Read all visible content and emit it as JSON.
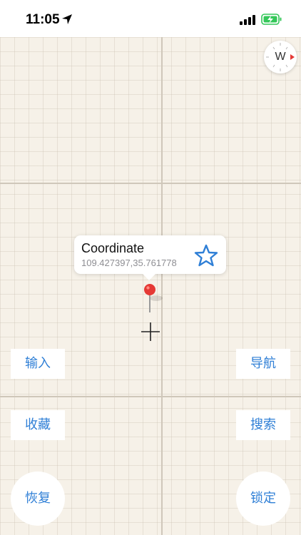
{
  "status_bar": {
    "time": "11:05",
    "location_icon": "location-arrow-icon",
    "signal_icon": "cellular-signal-icon",
    "battery_icon": "battery-charging-icon",
    "battery_color": "#34c759"
  },
  "compass": {
    "direction_letter": "W",
    "icon": "compass-icon",
    "needle_color": "#e53935"
  },
  "callout": {
    "title": "Coordinate",
    "coordinates": "109.427397,35.761778",
    "favorite_icon": "star-outline-icon"
  },
  "map": {
    "background_color": "#f6f1e8",
    "pin_icon": "map-pin-icon",
    "pin_color": "#e53935",
    "crosshair_icon": "crosshair-icon"
  },
  "buttons": {
    "input_label": "输入",
    "navigate_label": "导航",
    "favorites_label": "收藏",
    "search_label": "搜索",
    "restore_label": "恢复",
    "lock_label": "锁定",
    "accent_color": "#2f7fd6"
  }
}
